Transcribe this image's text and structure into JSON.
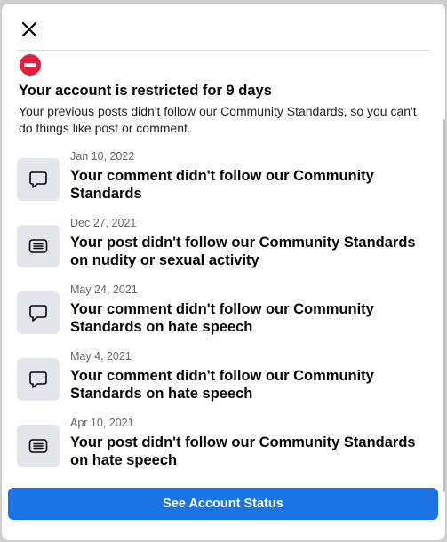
{
  "header": {
    "close_icon": "close-icon",
    "warning_icon": "restricted-icon"
  },
  "notice": {
    "title": "Your account is restricted for 9 days",
    "description": "Your previous posts didn't follow our Community Standards, so you can't do things like post or comment."
  },
  "violations": [
    {
      "date": "Jan 10, 2022",
      "text": "Your comment didn't follow our Community Standards",
      "icon": "comment-icon"
    },
    {
      "date": "Dec 27, 2021",
      "text": "Your post didn't follow our Community Standards on nudity or sexual activity",
      "icon": "post-icon"
    },
    {
      "date": "May 24, 2021",
      "text": "Your comment didn't follow our Community Standards on hate speech",
      "icon": "comment-icon"
    },
    {
      "date": "May 4, 2021",
      "text": "Your comment didn't follow our Community Standards on hate speech",
      "icon": "comment-icon"
    },
    {
      "date": "Apr 10, 2021",
      "text": "Your post didn't follow our Community Standards on hate speech",
      "icon": "post-icon"
    }
  ],
  "cta": {
    "label": "See Account Status"
  },
  "colors": {
    "accent": "#1b74e4",
    "warning": "#e41e3f"
  }
}
